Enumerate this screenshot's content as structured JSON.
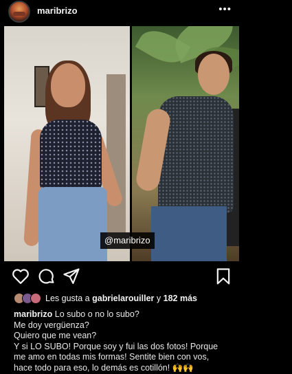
{
  "post": {
    "username": "maribrizo",
    "more_label": "•••",
    "tag_label": "@maribrizo"
  },
  "likes": {
    "prefix": "Les gusta a ",
    "user": "gabrielarouiller",
    "middle": " y ",
    "count": "182 más"
  },
  "caption": {
    "username": "maribrizo",
    "lines": [
      "Lo subo o no lo subo?",
      "Me doy vergüenza?",
      "Quiero que me vean?",
      "Y si LO SUBO! Porque soy y fui las dos fotos! Porque",
      "me amo en todas mis formas! Sentite bien con vos,",
      "hace todo para eso, lo demás es cotillón! 🙌🙌"
    ]
  },
  "icons": [
    "avatar",
    "more-icon",
    "heart-icon",
    "comment-icon",
    "share-icon",
    "save-icon"
  ],
  "colors": {
    "background": "#000000",
    "text": "#f2f2f2"
  }
}
